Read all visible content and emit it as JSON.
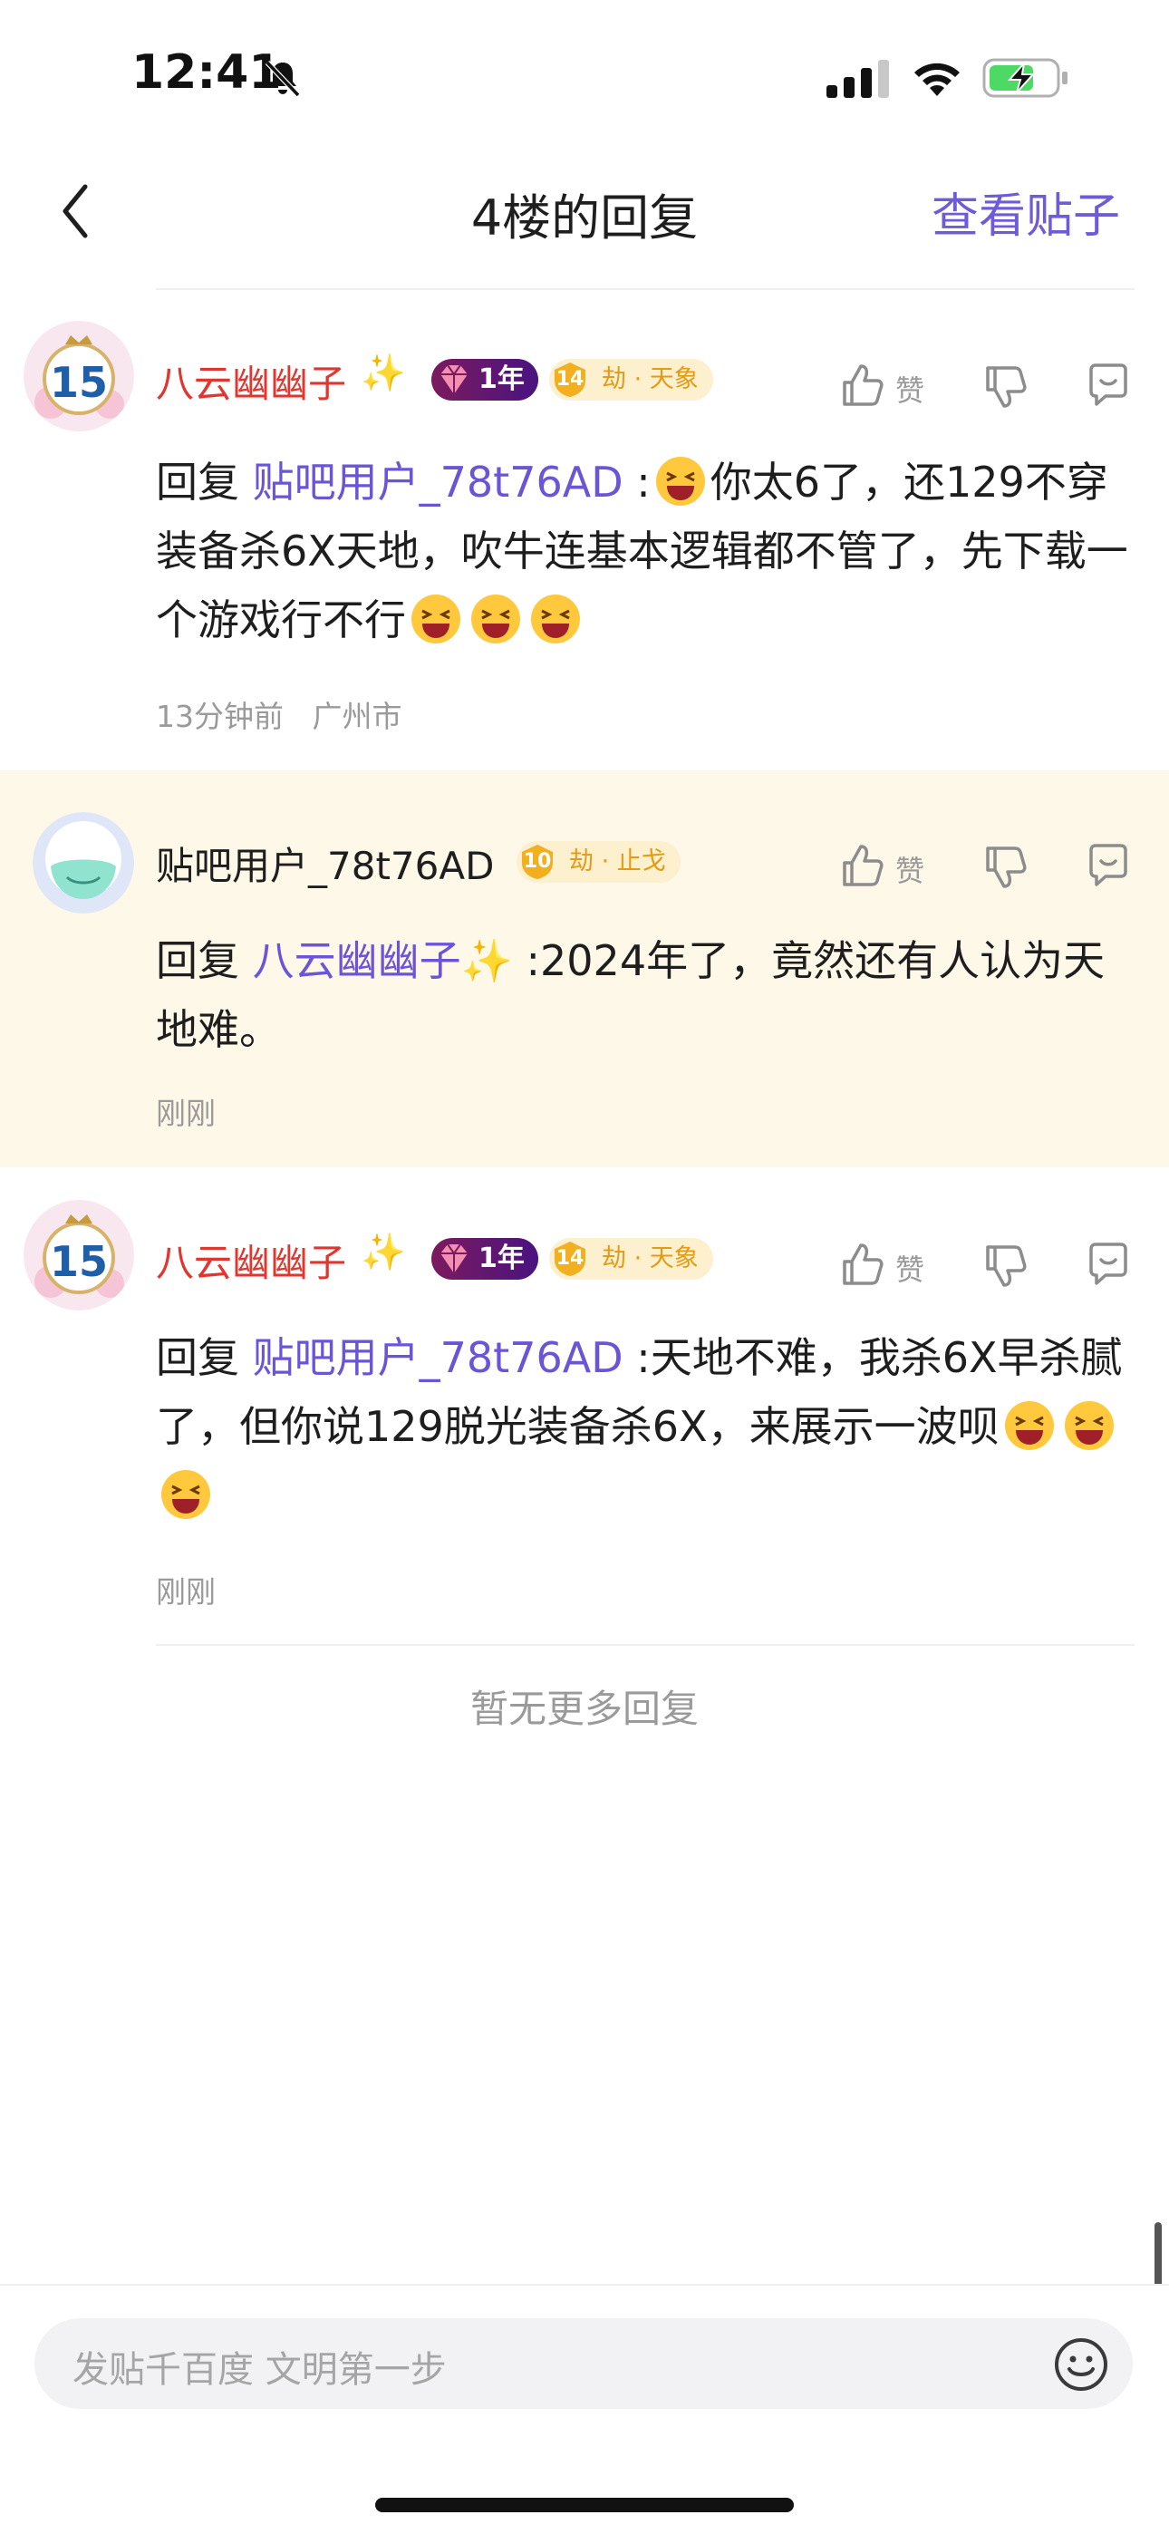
{
  "status": {
    "time": "12:41"
  },
  "nav": {
    "title": "4楼的回复",
    "right_link": "查看贴子"
  },
  "comments": [
    {
      "username": "八云幽幽子",
      "avatar_badge": "15",
      "year_badge": "1年",
      "level_num": "14",
      "level_label": "劫 · 天象",
      "like_label": "赞",
      "reply_prefix": "回复 ",
      "mention": "贴吧用户_78t76AD",
      "text1": " :",
      "text2": "你太6了，还129不穿装备杀6X天地，吹牛连基本逻辑都不管了，先下载一个游戏行不行",
      "time": "13分钟前",
      "location": "广州市"
    },
    {
      "username": "贴吧用户_78t76AD",
      "level_num": "10",
      "level_label": "劫 · 止戈",
      "like_label": "赞",
      "reply_prefix": "回复 ",
      "mention": "八云幽幽子",
      "text1": " :2024年了，竟然还有人认为天地难。",
      "time": "刚刚"
    },
    {
      "username": "八云幽幽子",
      "avatar_badge": "15",
      "year_badge": "1年",
      "level_num": "14",
      "level_label": "劫 · 天象",
      "like_label": "赞",
      "reply_prefix": "回复 ",
      "mention": "贴吧用户_78t76AD",
      "text1": " :天地不难，我杀6X早杀腻了，但你说129脱光装备杀6X，来展示一波呗",
      "time": "刚刚"
    }
  ],
  "footer": {
    "no_more": "暂无更多回复"
  },
  "input": {
    "placeholder": "发贴千百度 文明第一步"
  },
  "colors": {
    "accent": "#6f5bd8",
    "mention": "#6b55d6",
    "username_red": "#e0362f",
    "highlight_bg": "#fdf8e8"
  }
}
